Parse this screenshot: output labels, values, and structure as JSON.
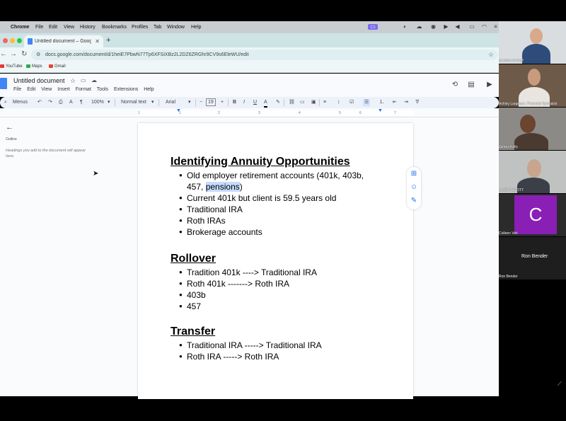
{
  "mac": {
    "app": "Chrome",
    "menus": [
      "File",
      "Edit",
      "View",
      "History",
      "Bookmarks",
      "Profiles",
      "Tab",
      "Window",
      "Help"
    ]
  },
  "browser": {
    "tab_title": "Untitled document – Google",
    "url": "docs.google.com/document/d/1heiE7PbwN77Tp6XFSiXBz2L2DZ6ZRGhr9CV9s6EleWU/edit",
    "bookmarks": [
      "YouTube",
      "Maps",
      "Gmail"
    ]
  },
  "docs": {
    "title": "Untitled document",
    "menus": [
      "File",
      "Edit",
      "View",
      "Insert",
      "Format",
      "Tools",
      "Extensions",
      "Help"
    ],
    "toolbar": {
      "menus_label": "Menus",
      "zoom": "100%",
      "style": "Normal text",
      "font": "Arial",
      "font_size": "19"
    },
    "ruler": [
      "1",
      "1",
      "2",
      "3",
      "4",
      "5",
      "6",
      "7"
    ],
    "outline": {
      "label": "Outline",
      "hint": "Headings you add to the document will appear here."
    }
  },
  "document": {
    "sections": [
      {
        "heading": "Identifying Annuity Opportunities",
        "items": [
          "Old employer retirement accounts (401k, 403b,",
          "Current 401k but client is 59.5 years old",
          "Traditional IRA",
          "Roth IRAs",
          "Brokerage accounts"
        ],
        "item0_line2_a": "457, ",
        "item0_line2_highlight": "pensions",
        "item0_line2_b": ")"
      },
      {
        "heading": "Rollover",
        "items": [
          "Tradition 401k ----> Traditional IRA",
          "Roth 401k -------> Roth IRA",
          "403b",
          "457"
        ]
      },
      {
        "heading": "Transfer",
        "items": [
          "Traditional IRA -----> Traditional IRA",
          "Roth IRA -----> Roth IRA"
        ]
      }
    ]
  },
  "participants": [
    {
      "name": "brandon lenhoff"
    },
    {
      "name": "Ashley Largesse, Financial Specialist"
    },
    {
      "name": "James Kelly"
    },
    {
      "name": "JASON SCOTT"
    },
    {
      "name": "Colleen Veit",
      "initial": "C",
      "color": "#8a1fb6"
    },
    {
      "name": "Ron Bender"
    }
  ]
}
